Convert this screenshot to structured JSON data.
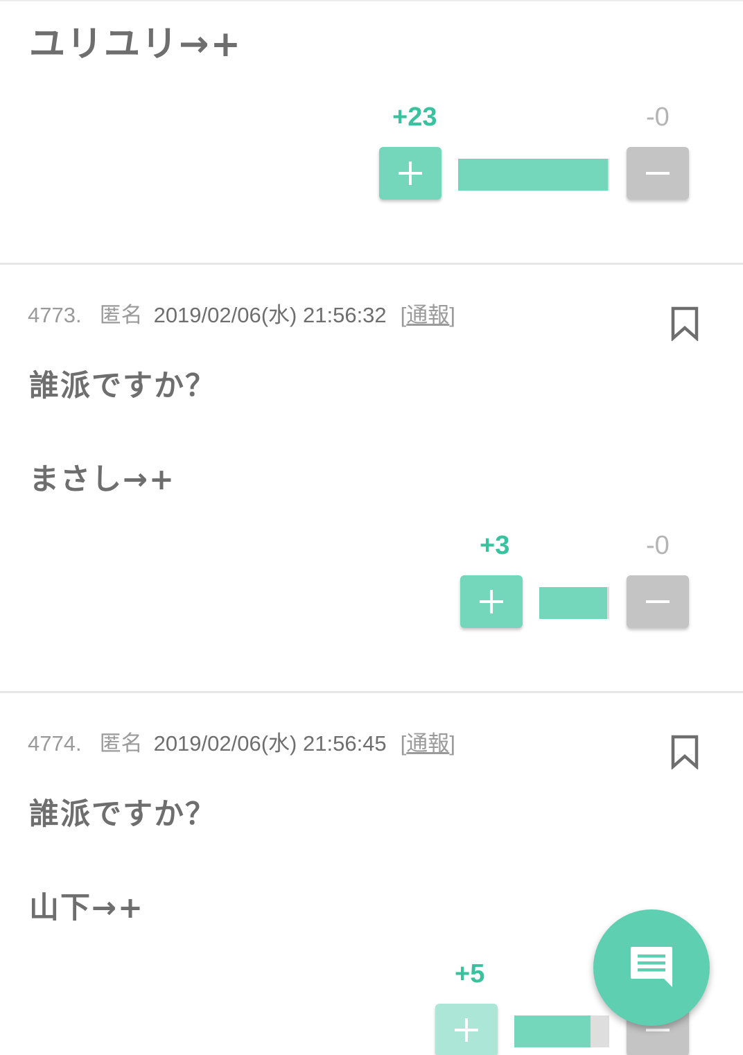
{
  "colors": {
    "accent": "#74d6bb",
    "accent_text": "#3ac29f",
    "minus_button": "#c4c4c4",
    "text": "#6e6e6e",
    "fab": "#5ecfb0"
  },
  "top_comment": {
    "body_lines": [
      "ユリユリ→+"
    ],
    "votes": {
      "plus_label": "+23",
      "minus_label": "-0",
      "plus_ratio": 0.99
    }
  },
  "comments": [
    {
      "number": "4773.",
      "author": "匿名",
      "datetime": "2019/02/06(水) 21:56:32",
      "report_open": "[",
      "report_label": "通報",
      "report_close": "]",
      "body_lines": [
        "誰派ですか？",
        "まさし→+"
      ],
      "votes": {
        "plus_label": "+3",
        "minus_label": "-0",
        "plus_ratio": 0.97
      }
    },
    {
      "number": "4774.",
      "author": "匿名",
      "datetime": "2019/02/06(水) 21:56:45",
      "report_open": "[",
      "report_label": "通報",
      "report_close": "]",
      "body_lines": [
        "誰派ですか？",
        "山下→+"
      ],
      "votes": {
        "plus_label": "+5",
        "minus_label": "",
        "plus_ratio": 0.8
      }
    }
  ],
  "icons": {
    "bookmark": "bookmark-icon",
    "plus": "plus-icon",
    "minus": "minus-icon",
    "fab": "chat-icon"
  }
}
